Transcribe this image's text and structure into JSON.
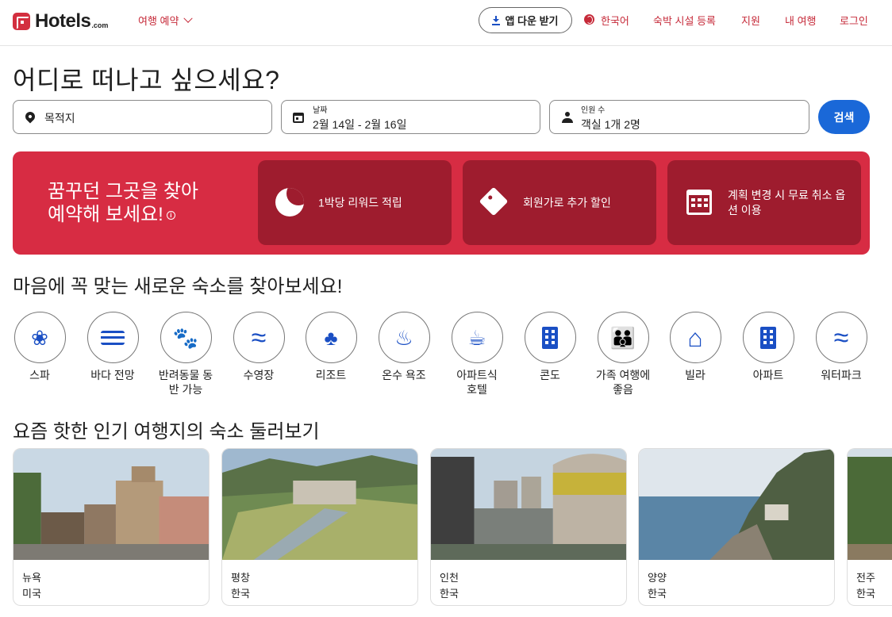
{
  "header": {
    "logo_text": "Hotels",
    "logo_suffix": ".com",
    "trip_menu": "여행 예약",
    "app_button": "앱 다운 받기",
    "language": "한국어",
    "list_property": "숙박 시설 등록",
    "support": "지원",
    "my_trips": "내 여행",
    "login": "로그인"
  },
  "headline": "어디로 떠나고 싶으세요?",
  "search": {
    "destination_placeholder": "목적지",
    "dates_label": "날짜",
    "dates_value": "2월 14일 - 2월 16일",
    "travelers_label": "인원 수",
    "travelers_value": "객실 1개 2명",
    "search_button": "검색"
  },
  "banner": {
    "title_line1": "꿈꾸던 그곳을 찾아",
    "title_line2": "예약해 보세요!",
    "info_glyph": "i",
    "perks": [
      {
        "icon": "moon-icon",
        "text": "1박당 리워드 적립"
      },
      {
        "icon": "tag-icon",
        "text": "회원가로 추가 할인"
      },
      {
        "icon": "calendar-icon",
        "text": "계획 변경 시 무료 취소 옵션 이용"
      }
    ],
    "bg_color": "#d72c43",
    "perk_bg_color": "#9e1c2e"
  },
  "categories_title": "마음에 꼭 맞는 새로운 숙소를 찾아보세요!",
  "categories": [
    {
      "label": "스파",
      "icon": "spa-icon",
      "glyph": "❀"
    },
    {
      "label": "바다 전망",
      "icon": "ocean-view-icon",
      "glyph": "≋"
    },
    {
      "label": "반려동물 동반 가능",
      "icon": "paw-icon",
      "glyph": "🐾"
    },
    {
      "label": "수영장",
      "icon": "pool-icon",
      "glyph": "≈"
    },
    {
      "label": "리조트",
      "icon": "palm-tree-icon",
      "glyph": "♣"
    },
    {
      "label": "온수 욕조",
      "icon": "hot-tub-icon",
      "glyph": "♨"
    },
    {
      "label": "아파트식 호텔",
      "icon": "aparthotel-icon",
      "glyph": "☕"
    },
    {
      "label": "콘도",
      "icon": "condo-icon",
      "glyph": ""
    },
    {
      "label": "가족 여행에 좋음",
      "icon": "family-icon",
      "glyph": "👪"
    },
    {
      "label": "빌라",
      "icon": "villa-icon",
      "glyph": "⌂"
    },
    {
      "label": "아파트",
      "icon": "apartment-icon",
      "glyph": ""
    },
    {
      "label": "워터파크",
      "icon": "water-park-icon",
      "glyph": "≈"
    }
  ],
  "destinations_title": "요즘 핫한 인기 여행지의 숙소 둘러보기",
  "destinations": [
    {
      "city": "뉴욕",
      "country": "미국"
    },
    {
      "city": "평창",
      "country": "한국"
    },
    {
      "city": "인천",
      "country": "한국"
    },
    {
      "city": "양양",
      "country": "한국"
    },
    {
      "city": "전주",
      "country": "한국"
    }
  ],
  "colors": {
    "brand_red": "#c62a39",
    "accent_blue": "#1a68d8",
    "icon_blue": "#1a4fc4"
  }
}
